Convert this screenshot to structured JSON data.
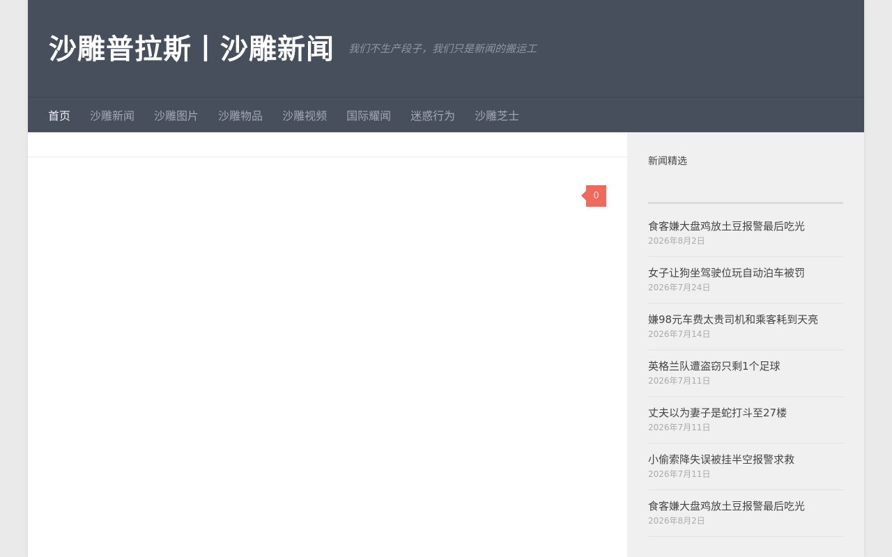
{
  "header": {
    "site_title": "沙雕普拉斯丨沙雕新闻",
    "tagline": "我们不生产段子，我们只是新闻的搬运工"
  },
  "nav": {
    "items": [
      {
        "label": "首页",
        "active": true
      },
      {
        "label": "沙雕新闻"
      },
      {
        "label": "沙雕图片"
      },
      {
        "label": "沙雕物品"
      },
      {
        "label": "沙雕视频"
      },
      {
        "label": "国际耀闻"
      },
      {
        "label": "迷惑行为"
      },
      {
        "label": "沙雕芝士"
      }
    ]
  },
  "main": {
    "comment_count": "0"
  },
  "sidebar": {
    "title": "新闻精选",
    "posts": [
      {
        "title": "食客嫌大盘鸡放土豆报警最后吃光",
        "date": "2026年8月2日"
      },
      {
        "title": "女子让狗坐驾驶位玩自动泊车被罚",
        "date": "2026年7月24日"
      },
      {
        "title": "嫌98元车费太贵司机和乘客耗到天亮",
        "date": "2026年7月14日"
      },
      {
        "title": "英格兰队遭盗窃只剩1个足球",
        "date": "2026年7月11日"
      },
      {
        "title": "丈夫以为妻子是蛇打斗至27楼",
        "date": "2026年7月11日"
      },
      {
        "title": "小偷索降失误被挂半空报警求救",
        "date": "2026年7月11日"
      },
      {
        "title": "食客嫌大盘鸡放土豆报警最后吃光",
        "date": "2026年8月2日"
      }
    ]
  },
  "colors": {
    "header_bg": "#474f5c",
    "accent": "#f0695d",
    "sidebar_bg": "#f0f0f0"
  }
}
